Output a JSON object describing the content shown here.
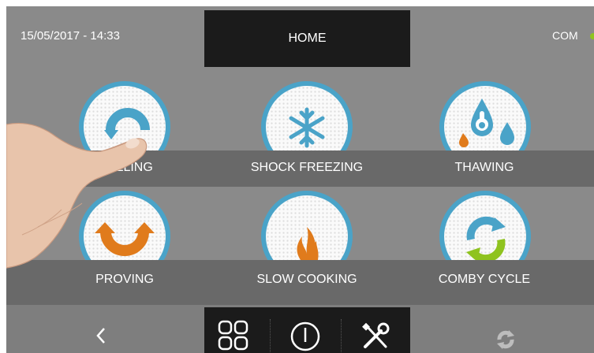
{
  "header": {
    "datetime": "15/05/2017 - 14:33",
    "title": "HOME",
    "status": "COM",
    "status_color": "#8fc31f"
  },
  "programs": [
    {
      "label": "BLAST CHILLING",
      "visible_label": "CHILLING",
      "icon": "blast-chilling-icon"
    },
    {
      "label": "SHOCK FREEZING",
      "icon": "snowflake-icon"
    },
    {
      "label": "THAWING",
      "icon": "thawing-drops-icon"
    },
    {
      "label": "PROVING",
      "icon": "proving-arrow-icon"
    },
    {
      "label": "SLOW COOKING",
      "icon": "flames-icon"
    },
    {
      "label": "COMBY CYCLE",
      "icon": "cycle-arrows-icon"
    }
  ],
  "footer": {
    "back_icon": "chevron-left-icon",
    "menu_icon": "grid-menu-icon",
    "power_icon": "power-icon",
    "tools_icon": "tools-icon",
    "sync_icon": "sync-icon"
  },
  "colors": {
    "background": "#8a8a8a",
    "band": "#696969",
    "dark_box": "#1b1b1b",
    "ring": "#4aa3c8",
    "orange": "#e07b1c",
    "green": "#8fc31f"
  }
}
